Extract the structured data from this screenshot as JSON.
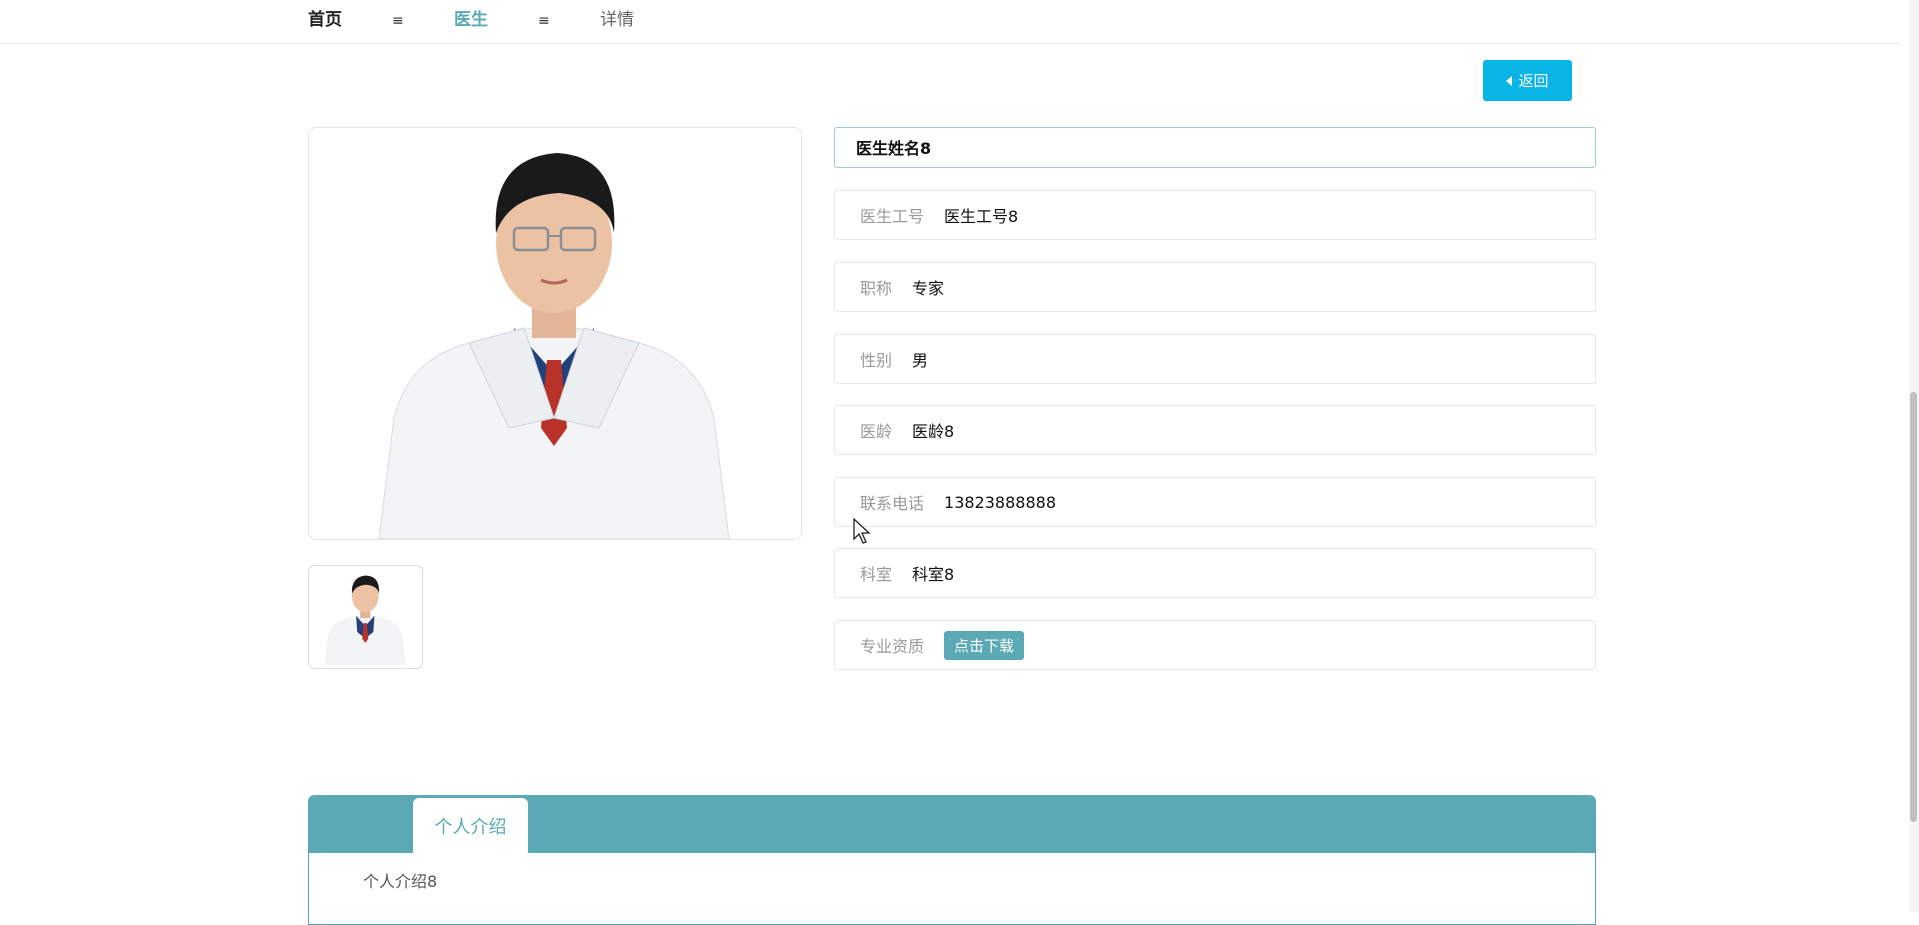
{
  "breadcrumb": {
    "home": "首页",
    "sep1": "≡",
    "doctor": "医生",
    "sep2": "≡",
    "detail": "详情"
  },
  "back_button": {
    "label": "返回"
  },
  "doctor": {
    "name": "医生姓名8",
    "fields": [
      {
        "label": "医生工号",
        "value": "医生工号8"
      },
      {
        "label": "职称",
        "value": "专家"
      },
      {
        "label": "性别",
        "value": "男"
      },
      {
        "label": "医龄",
        "value": "医龄8"
      },
      {
        "label": "联系电话",
        "value": "13823888888"
      },
      {
        "label": "科室",
        "value": "科室8"
      },
      {
        "label": "专业资质",
        "action": "点击下载"
      }
    ]
  },
  "tabs": [
    {
      "label": "个人介绍",
      "active": true
    }
  ],
  "intro": {
    "text": "个人介绍8"
  },
  "colors": {
    "accent": "#5aa9b4",
    "back_button": "#08b5e6",
    "label_gray": "#999999"
  }
}
